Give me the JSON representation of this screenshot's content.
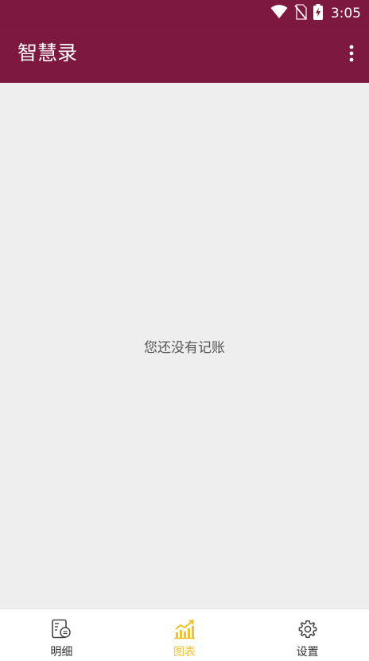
{
  "status_bar": {
    "time": "3:05",
    "icons": [
      "wifi-icon",
      "no-sim-icon",
      "battery-charging-icon"
    ]
  },
  "app_bar": {
    "title": "智慧录",
    "menu_icon": "more-vert-icon"
  },
  "main": {
    "empty_message": "您还没有记账"
  },
  "bottom_nav": {
    "items": [
      {
        "label": "明细",
        "icon": "ledger-icon",
        "active": false
      },
      {
        "label": "图表",
        "icon": "chart-icon",
        "active": true
      },
      {
        "label": "设置",
        "icon": "gear-icon",
        "active": false
      }
    ]
  },
  "colors": {
    "primary": "#7d1840",
    "accent": "#f2c12e",
    "background": "#eeeeee"
  }
}
